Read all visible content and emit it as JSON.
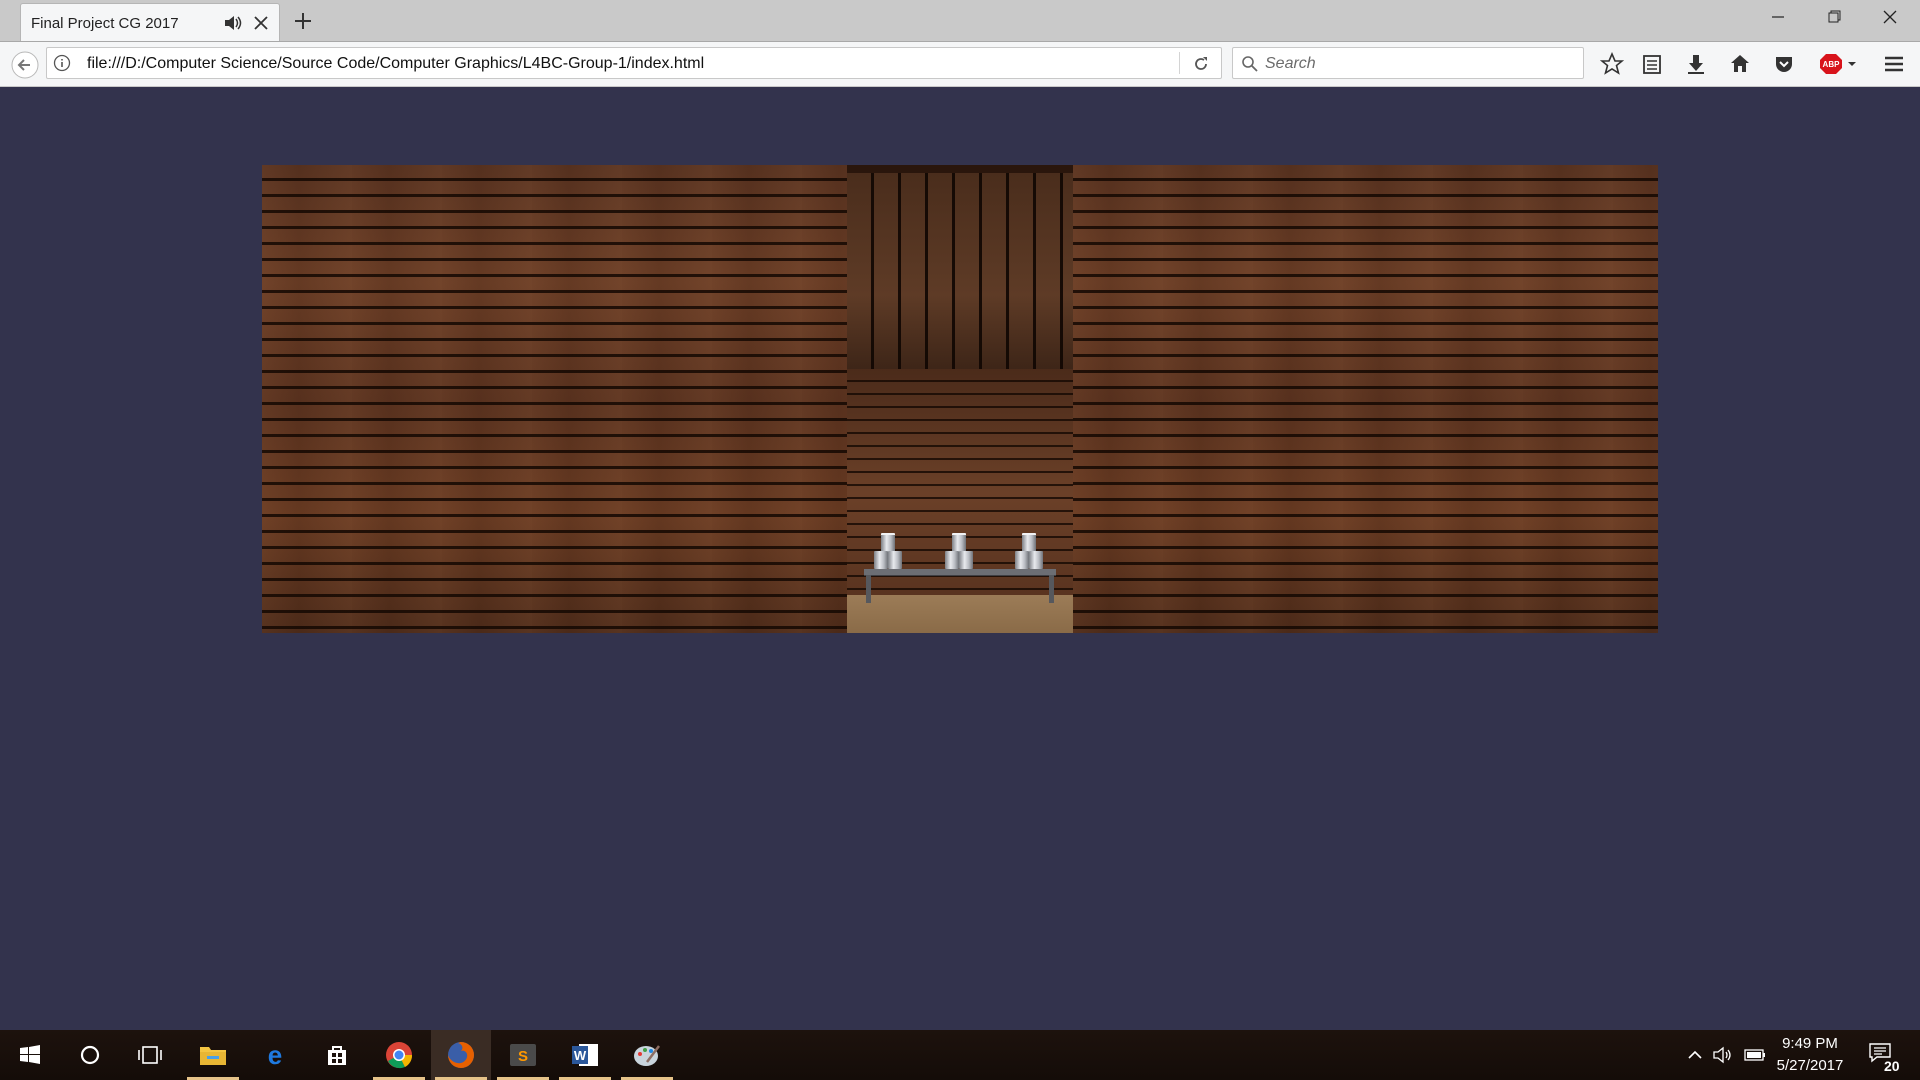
{
  "tab": {
    "title": "Final Project CG 2017"
  },
  "navbar": {
    "url": "file:///D:/Computer Science/Source Code/Computer Graphics/L4BC-Group-1/index.html",
    "search_placeholder": "Search"
  },
  "toolbar": {
    "icons": [
      "bookmark-star-icon",
      "reading-list-icon",
      "download-icon",
      "home-icon",
      "pocket-icon",
      "adblock-plus-icon",
      "menu-icon"
    ],
    "adblock_label": "ABP"
  },
  "page": {
    "background": "#33334d",
    "scene": {
      "description_elements": [
        "left-wood-wall",
        "shooting-booth",
        "right-wood-wall"
      ],
      "can_stacks": 3,
      "cans_per_stack": 3
    }
  },
  "taskbar": {
    "apps": [
      "start",
      "cortana",
      "task-view",
      "file-explorer",
      "edge",
      "store",
      "chrome",
      "firefox",
      "sublime-text",
      "word",
      "paint"
    ],
    "active_app": "firefox",
    "clock": {
      "time": "9:49 PM",
      "date": "5/27/2017"
    },
    "notifications": "20"
  },
  "colors": {
    "tabstrip": "#c9c9c9",
    "navbar": "#f5f6f7",
    "page_bg": "#33334d",
    "taskbar": "#1d120d",
    "accent_underline": "#e6c389"
  }
}
